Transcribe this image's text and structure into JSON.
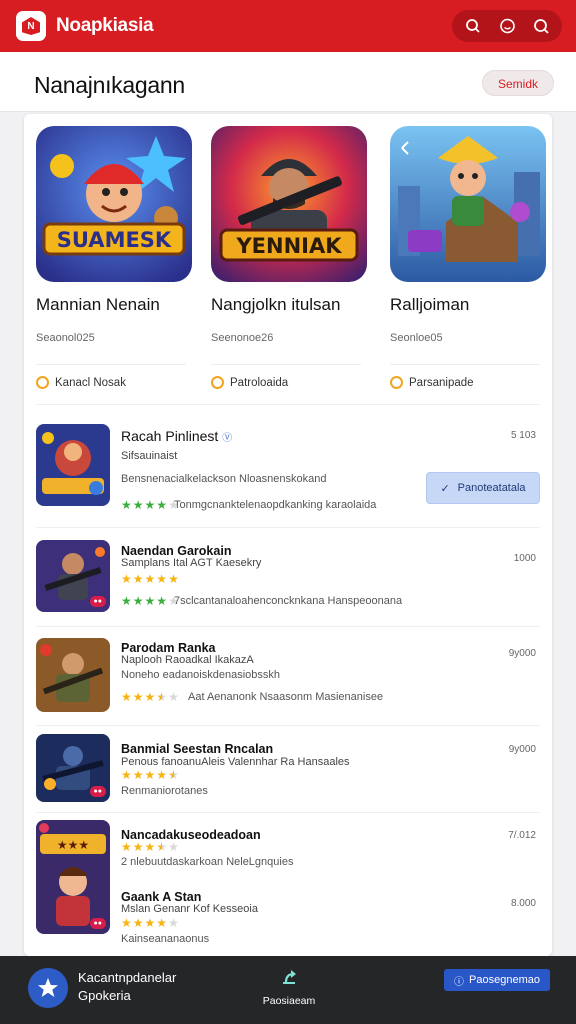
{
  "app": {
    "title": "Noapkiasia",
    "brand_color": "#d71d22"
  },
  "top_actions": [
    "search-icon",
    "chat-icon",
    "notifications-icon"
  ],
  "header": {
    "title": "Nanajnıkagann",
    "action_label": "Semidk"
  },
  "featured": [
    {
      "art": "SUAMESK",
      "name": "Mannian Nenain",
      "meta": "Seaonol025",
      "tag": "Kanacl Nosak"
    },
    {
      "art": "YENNIAK",
      "name": "Nangjolkn itulsan",
      "meta": "Seenonoe26",
      "tag": "Patroloaida"
    },
    {
      "art": "",
      "name": "Ralljoiman",
      "meta": "Seonloe05",
      "tag": "Parsanipade"
    }
  ],
  "list": [
    {
      "title": "Racah Pinlinest",
      "subtitle": "Sifsauinaist",
      "desc": "Bensnenacialkelackson Nloasnenskokand",
      "rating": 4,
      "reviews": "Tonmgcnanktelenaopdkanking karaolaida",
      "price": "5 103",
      "install_label": "Panoteatatala",
      "star_color": "#3cae3c"
    },
    {
      "title": "Naendan Garokain",
      "subtitle": "Samplans Ital AGT Kaesekry",
      "rating": 5,
      "reviews": "7sclcantanaloahenconcknkana Hanspeoonana",
      "price": "1000",
      "star_color": "#f5b40f"
    },
    {
      "title": "Parodam Ranka",
      "subtitle": "Naplooh Raoadkal IkakazА",
      "desc": "Noneho eadanoiskdenasiobsskh",
      "rating": 3.5,
      "reviews": "Aat Aenanonk Nsaasonm Masienanisee",
      "price": "9у000",
      "star_color": "#f5b40f"
    },
    {
      "title": "Banmial Seestan Rncalan",
      "subtitle": "Penous fanoanuAleis Valennhar Ra Hansaales",
      "rating": 4.5,
      "reviews": "Renmaniorotanes",
      "price": "9у000",
      "star_color": "#f5b40f"
    },
    {
      "title": "Nancadakuseodeadoan",
      "rating": 3.5,
      "reviews": "2 nlebuutdaskarkoan NeleLgnquies",
      "price": "7/.012",
      "star_color": "#f5b40f"
    },
    {
      "title": "Gaank A Stan",
      "subtitle": "Mslan Genanr Kof Kesseoia",
      "rating": 4,
      "reviews": "Kainseananaonus",
      "price": "8.000",
      "star_color": "#f5b40f"
    }
  ],
  "bottom": {
    "primary_line1": "Kacantnpdanelar",
    "primary_line2": "Gpokeria",
    "center_label": "Paosiaeam",
    "right_label": "Paosegnemao"
  }
}
